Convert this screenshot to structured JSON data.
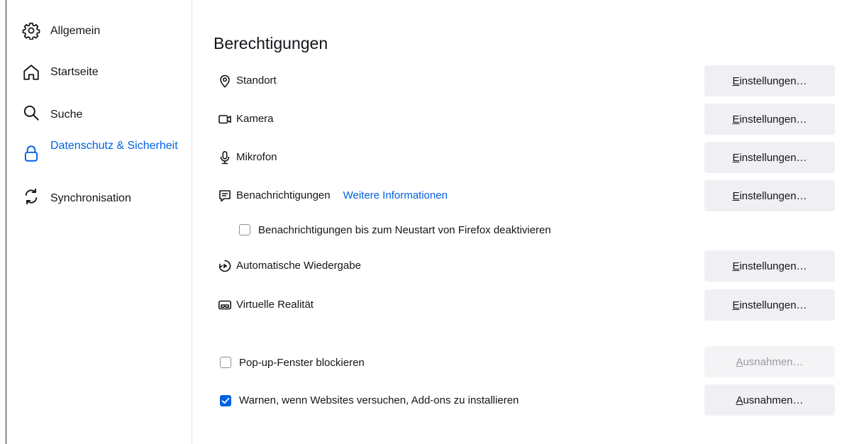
{
  "sidebar": {
    "items": [
      {
        "label": "Allgemein",
        "icon": "gear-icon"
      },
      {
        "label": "Startseite",
        "icon": "home-icon"
      },
      {
        "label": "Suche",
        "icon": "search-icon"
      },
      {
        "label": "Datenschutz & Sicherheit",
        "icon": "lock-icon",
        "active": true
      },
      {
        "label": "Synchronisation",
        "icon": "sync-icon"
      }
    ]
  },
  "main": {
    "section_title": "Berechtigungen",
    "permissions": [
      {
        "label": "Standort",
        "icon": "location-pin-icon",
        "button": "Einstellungen…"
      },
      {
        "label": "Kamera",
        "icon": "camera-icon",
        "button": "Einstellungen…"
      },
      {
        "label": "Mikrofon",
        "icon": "microphone-icon",
        "button": "Einstellungen…"
      },
      {
        "label": "Benachrichtigungen",
        "icon": "notification-icon",
        "link": "Weitere Informationen",
        "button": "Einstellungen…"
      },
      {
        "label": "Automatische Wiedergabe",
        "icon": "autoplay-icon",
        "button": "Einstellungen…"
      },
      {
        "label": "Virtuelle Realität",
        "icon": "vr-headset-icon",
        "button": "Einstellungen…"
      }
    ],
    "notifications_pause": {
      "label": "Benachrichtigungen bis zum Neustart von Firefox deaktivieren",
      "checked": false
    },
    "popup_block": {
      "label": "Pop-up-Fenster blockieren",
      "checked": false,
      "button": "Ausnahmen…",
      "button_disabled": true
    },
    "addon_warn": {
      "label": "Warnen, wenn Websites versuchen, Add-ons zu installieren",
      "checked": true,
      "button": "Ausnahmen…"
    }
  },
  "colors": {
    "accent": "#0061e0",
    "button_bg": "#f0f0f4",
    "text": "#15141a"
  }
}
